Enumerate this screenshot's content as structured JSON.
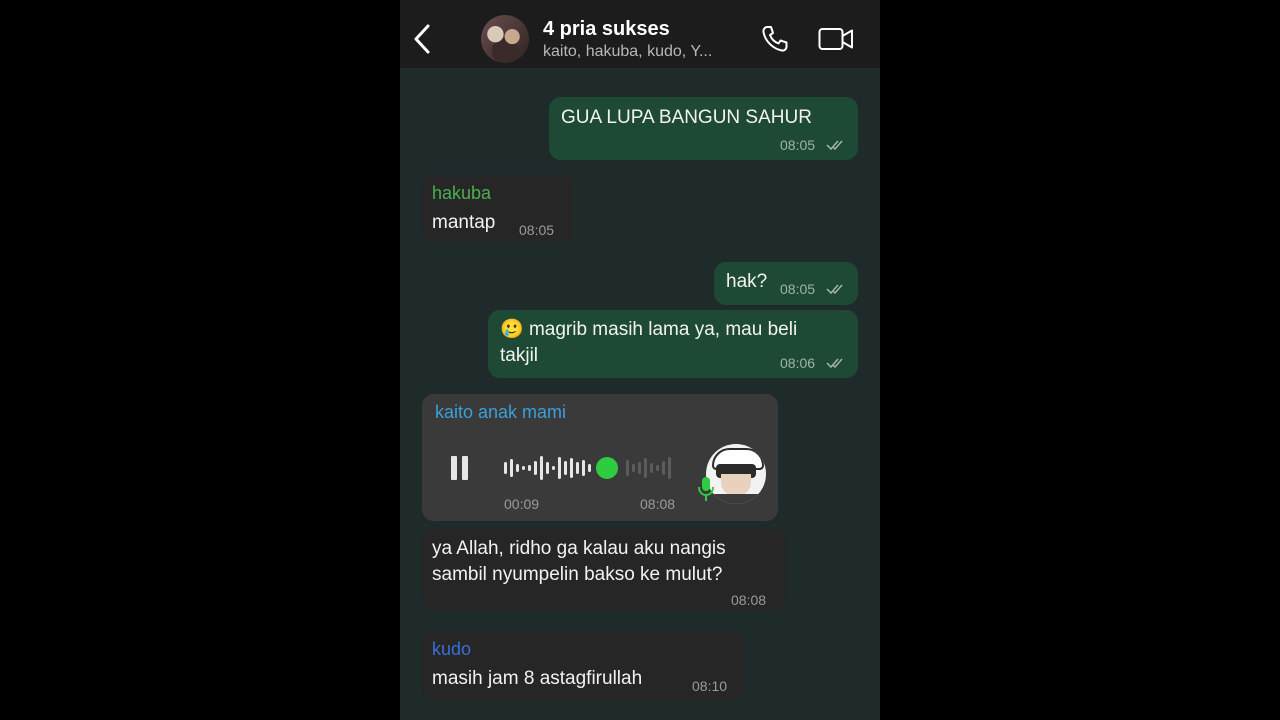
{
  "header": {
    "title": "4 pria sukses",
    "subtitle": "kaito, hakuba, kudo, Y..."
  },
  "messages": [
    {
      "text": "GUA LUPA BANGUN SAHUR",
      "time": "08:05"
    },
    {
      "sender": "hakuba",
      "text": "mantap",
      "time": "08:05"
    },
    {
      "text": "hak?",
      "time": "08:05"
    },
    {
      "emoji": "🥲",
      "text_line1": "magrib masih lama ya, mau beli",
      "text_line2": "takjil",
      "time": "08:06"
    },
    {
      "sender": "kaito anak mami",
      "voice_duration": "00:09",
      "time": "08:08"
    },
    {
      "text_line1": "ya Allah, ridho ga kalau aku nangis",
      "text_line2": "sambil nyumpelin bakso ke mulut?",
      "time": "08:08"
    },
    {
      "sender": "kudo",
      "text": "masih jam 8 astagfirullah",
      "time": "08:10"
    }
  ],
  "colors": {
    "hakuba": "#4caf50",
    "kaito": "#3aa0d8",
    "kudo": "#3a6fd8",
    "outgoing_bubble": "#1e4a35",
    "incoming_bubble": "#262626",
    "voice_progress": "#2ecc40"
  },
  "icons": [
    "back-icon",
    "phone-icon",
    "video-call-icon",
    "double-check-icon",
    "pause-icon",
    "microphone-icon"
  ]
}
